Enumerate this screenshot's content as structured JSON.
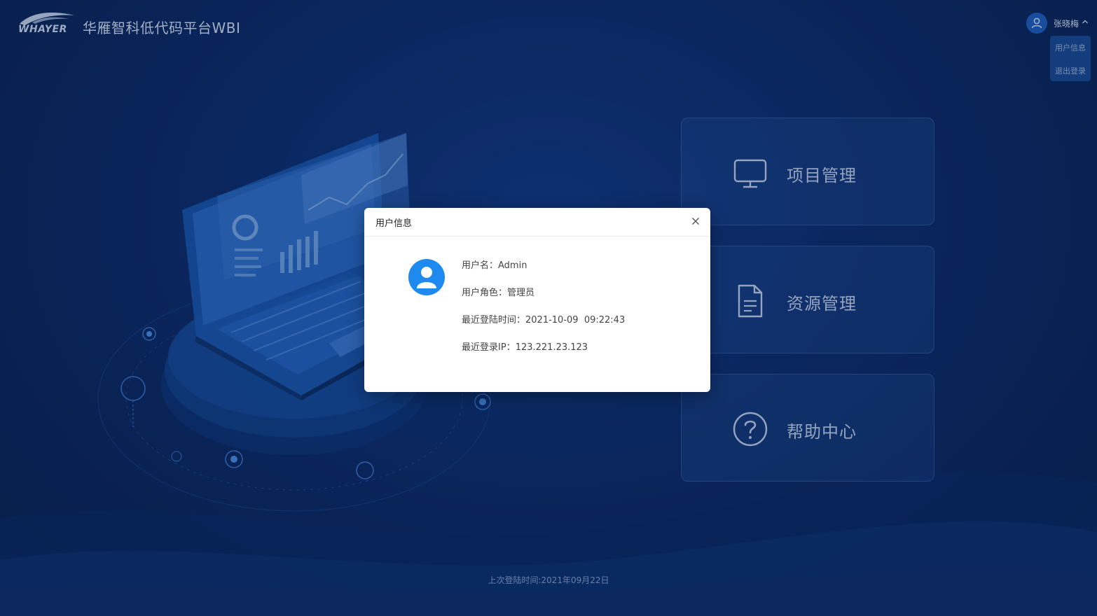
{
  "header": {
    "logo_text": "WHAYER",
    "app_title": "华雁智科低代码平台WBI"
  },
  "user": {
    "name": "张晓梅",
    "menu": [
      {
        "label": "用户信息"
      },
      {
        "label": "退出登录"
      }
    ]
  },
  "cards": [
    {
      "label": "项目管理",
      "icon": "monitor-icon"
    },
    {
      "label": "资源管理",
      "icon": "document-icon"
    },
    {
      "label": "帮助中心",
      "icon": "help-icon"
    }
  ],
  "footer": {
    "last_login": "上次登陆时间:2021年09月22日"
  },
  "modal": {
    "title": "用户信息",
    "username_label": "用户名：",
    "username": "Admin",
    "role_label": "用户角色：",
    "role": "管理员",
    "login_time_label": "最近登陆时间：",
    "login_time": "2021-10-09  09:22:43",
    "login_ip_label": "最近登录IP：",
    "login_ip": "123.221.23.123"
  },
  "colors": {
    "background": "#0c2c6c",
    "accent": "#1e8af0",
    "card_text": "#c5d4ee"
  }
}
